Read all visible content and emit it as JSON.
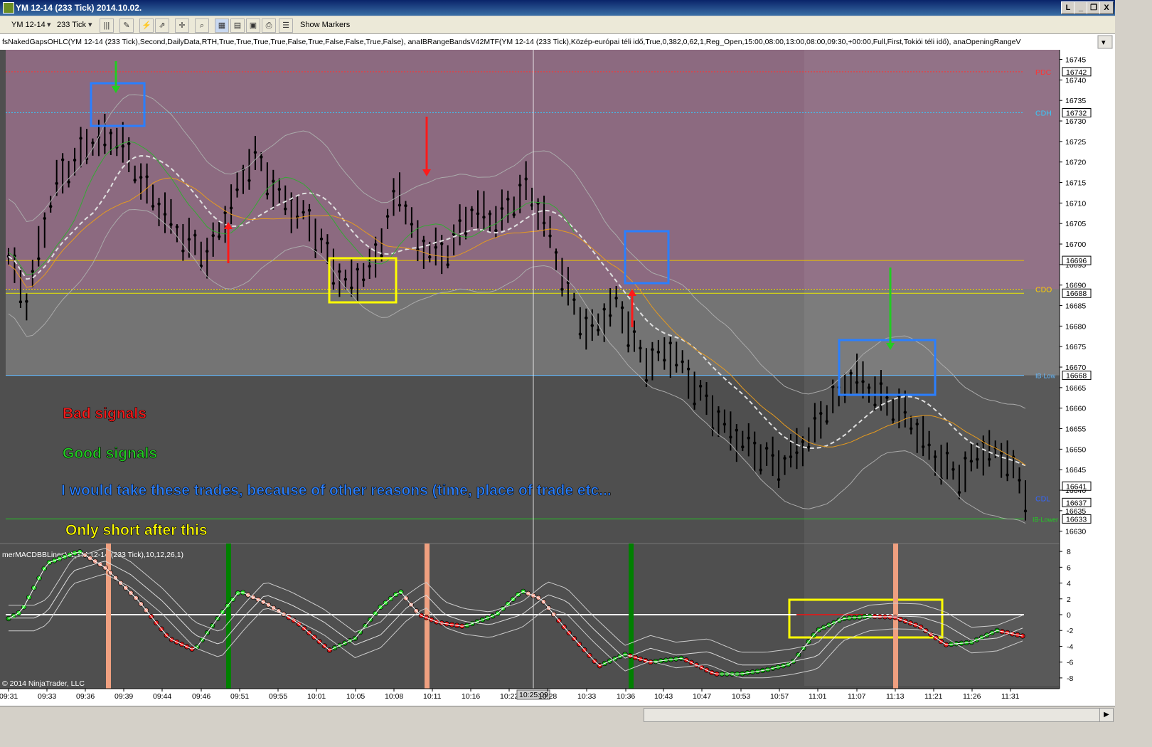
{
  "window": {
    "title": "YM 12-14 (233 Tick)  2014.10.02.",
    "buttons": [
      "L",
      "_",
      "❐",
      "X"
    ]
  },
  "toolbar": {
    "instrument": "YM 12-14",
    "period": "233 Tick",
    "show_markers": "Show Markers"
  },
  "indicator_label": "fsNakedGapsOHLC(YM 12-14 (233 Tick),Second,DailyData,RTH,True,True,True,True,False,True,False,False,True,False), anaIBRangeBandsV42MTF(YM 12-14 (233 Tick),Közép-európai téli idő,True,0,382,0,62,1,Reg_Open,15:00,08:00,13:00,08:00,09:30,+00:00,Full,First,Tokiói téli idő), anaOpeningRangeV",
  "macd_label": "merMACDBBLinesV1(YM 12-14 (233 Tick),10,12,26,1)",
  "copyright": "© 2014 NinjaTrader, LLC",
  "annotations": {
    "bad": "Bad signals",
    "good": "Good signals",
    "blue": "I would take these trades, because of other reasons (time, place of trade etc...",
    "yellow": "Only short after this"
  },
  "colors": {
    "bad": "#ff1a1a",
    "good": "#22cc22",
    "blue": "#2a7fff",
    "yellow": "#ffff00",
    "pink_zone": "#8c6a80",
    "grey_zone": "#747474",
    "dark_bg": "#4f4f4f"
  },
  "chart_data": {
    "type": "bar",
    "price_axis": {
      "ylim": [
        16627,
        16747
      ],
      "ticks": [
        16745,
        16740,
        16735,
        16730,
        16725,
        16720,
        16715,
        16710,
        16705,
        16700,
        16695,
        16690,
        16685,
        16680,
        16675,
        16670,
        16665,
        16660,
        16655,
        16650,
        16645,
        16640,
        16635,
        16630
      ]
    },
    "price_labels": [
      {
        "text": "16742",
        "value": 16742
      },
      {
        "text": "16732",
        "value": 16732
      },
      {
        "text": "16696",
        "value": 16696
      },
      {
        "text": "16688",
        "value": 16688
      },
      {
        "text": "16668",
        "value": 16668
      },
      {
        "text": "16641",
        "value": 16641
      },
      {
        "text": "16637",
        "value": 16637
      },
      {
        "text": "16633",
        "value": 16633
      }
    ],
    "levels": [
      {
        "name": "PDC",
        "value": 16742
      },
      {
        "name": "CDH",
        "value": 16732
      },
      {
        "name": "CDO",
        "value": 16689
      },
      {
        "name": "IB-Low",
        "value": 16668
      },
      {
        "name": "CDL",
        "value": 16638
      },
      {
        "name": "IB-Lower",
        "value": 16633
      }
    ],
    "macd_axis": {
      "ylim": [
        -9,
        9
      ],
      "ticks": [
        8,
        6,
        4,
        2,
        0,
        -2,
        -4,
        -6,
        -8
      ]
    },
    "time_ticks": [
      "09:31",
      "09:33",
      "09:36",
      "09:39",
      "09:44",
      "09:46",
      "09:51",
      "09:55",
      "10:01",
      "10:05",
      "10:08",
      "10:11",
      "10:16",
      "10:22",
      "10:25:09",
      "10:28",
      "10:33",
      "10:36",
      "10:43",
      "10:47",
      "10:53",
      "10:57",
      "11:01",
      "11:07",
      "11:13",
      "11:21",
      "11:26",
      "11:31"
    ],
    "cursor_time": "10:25:09"
  }
}
